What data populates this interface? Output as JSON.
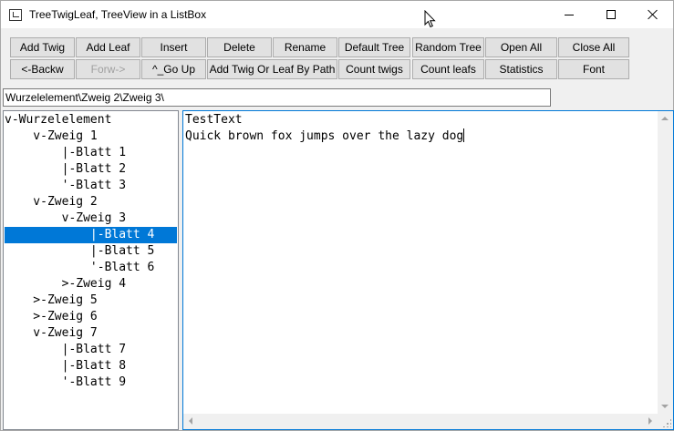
{
  "window": {
    "title": "TreeTwigLeaf, TreeView in a ListBox"
  },
  "toolbar": {
    "row1": [
      "Add Twig",
      "Add Leaf",
      "Insert",
      "Delete",
      "Rename",
      "Default Tree",
      "Random Tree",
      "Open All",
      "Close All"
    ],
    "row2": [
      "<-Backw",
      "Forw->",
      "^_Go Up",
      "Add Twig Or Leaf By Path",
      "Count twigs",
      "Count leafs",
      "Statistics",
      "Font"
    ],
    "disabled": [
      "Forw->"
    ]
  },
  "path": {
    "value": "Wurzelelement\\Zweig 2\\Zweig 3\\"
  },
  "tree": {
    "items": [
      "v-Wurzelelement",
      "    v-Zweig 1",
      "        |-Blatt 1",
      "        |-Blatt 2",
      "        '-Blatt 3",
      "    v-Zweig 2",
      "        v-Zweig 3",
      "            |-Blatt 4",
      "            |-Blatt 5",
      "            '-Blatt 6",
      "        >-Zweig 4",
      "    >-Zweig 5",
      "    >-Zweig 6",
      "    v-Zweig 7",
      "        |-Blatt 7",
      "        |-Blatt 8",
      "        '-Blatt 9"
    ],
    "selected_index": 7
  },
  "editor": {
    "lines": [
      "TestText",
      "Quick brown fox jumps over the lazy dog"
    ]
  },
  "icons": {
    "app": "app-window-icon",
    "minimize": "minimize-icon",
    "maximize": "maximize-icon",
    "close": "close-icon",
    "cursor": "mouse-cursor-icon"
  },
  "colors": {
    "selection": "#0078d7",
    "focus_border": "#0078d7",
    "button_face": "#e1e1e1",
    "disabled_text": "#a0a0a0"
  }
}
